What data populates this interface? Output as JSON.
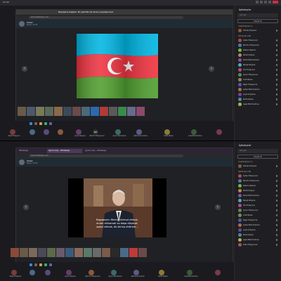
{
  "top": {
    "teams_bar": {
      "time": "23:30"
    },
    "tabs": [
      {
        "label": "WhatsApp"
      },
      {
        "label": "Ağ Ulu Göy - WhatsApp"
      }
    ],
    "banner": "Paylaşma başladı. Bu şəkildə siz ekranı paylaşırsınız",
    "url": "web.whatsapp.com",
    "chat": {
      "name": "Xəbər",
      "sub": "Bugün 12:00"
    },
    "media_alt": "flag-azerbaijan",
    "nav_prev": "‹",
    "nav_next": "›",
    "taskbar_time": "23:30",
    "attendees": [
      {
        "initials": "",
        "label": "Yasin Hüseynov",
        "color": "#7a3b3b"
      },
      {
        "initials": "",
        "label": "",
        "color": "#4a6a8a"
      },
      {
        "initials": "",
        "label": "",
        "color": "#5a4a7a"
      },
      {
        "initials": "",
        "label": "",
        "color": "#8a5a3a"
      },
      {
        "initials": "",
        "label": "Aynur Əliyeva",
        "color": "#6a3a6a"
      },
      {
        "initials": "NH",
        "label": "Nərmin Hüseynova",
        "color": "#303030"
      },
      {
        "initials": "",
        "label": "Aynur Əhmədova",
        "color": "#3a6a6a"
      },
      {
        "initials": "",
        "label": "Səbinə Axundova",
        "color": "#5a5a8a"
      },
      {
        "initials": "",
        "label": "Kamil Əliyev",
        "color": "#8a7a3a"
      },
      {
        "initials": "",
        "label": "Lalə Məmmədova",
        "color": "#3a5a3a"
      },
      {
        "initials": "",
        "label": "",
        "color": "#7a3a4a"
      }
    ]
  },
  "bottom": {
    "tabs": [
      {
        "label": "WhatsApp"
      },
      {
        "label": "Ağ Ulu Göy - WhatsApp"
      },
      {
        "label": "Ağ Ulu Göy - WhatsApp"
      }
    ],
    "url": "web.whatsapp.com",
    "chat": {
      "name": "Xəbər",
      "sub": "Bugün 12:00"
    },
    "subtitle_lines": [
      "Başqasının fikrinə hörmət etmək,",
      "onları dinləmək və başa düşmək,",
      "qəbul etmək, bir-birinə ehtiram..."
    ],
    "nav_prev": "‹",
    "nav_next": "›",
    "attendees": [
      {
        "initials": "",
        "label": "Yasin Hüseynov",
        "color": "#7a3b3b"
      },
      {
        "initials": "",
        "label": "",
        "color": "#4a6a8a"
      },
      {
        "initials": "",
        "label": "",
        "color": "#5a4a7a"
      },
      {
        "initials": "",
        "label": "Aynur Əliyeva",
        "color": "#6a3a6a"
      },
      {
        "initials": "",
        "label": "Nərmin Hüseynova",
        "color": "#8a5a3a"
      },
      {
        "initials": "",
        "label": "Aynur Əhmədova",
        "color": "#3a6a6a"
      },
      {
        "initials": "",
        "label": "Səbinə Axundova",
        "color": "#5a5a8a"
      },
      {
        "initials": "",
        "label": "Kamil Əliyev",
        "color": "#8a7a3a"
      },
      {
        "initials": "",
        "label": "Lalə Məmmədova",
        "color": "#3a5a3a"
      },
      {
        "initials": "",
        "label": "",
        "color": "#7a3a4a"
      }
    ]
  },
  "sidebar_top": {
    "title": "İştirakçılar",
    "search_placeholder": "Adı yaz",
    "invite_label": "Dəvət et",
    "section_presenters": "Təqdimatçılar (1)",
    "section_attendees": "İştirakçılar (28)",
    "presenter": {
      "name": "Vüsalə Quliyeva",
      "color": "#8a5a3a"
    },
    "people": [
      {
        "name": "Aytən Hüseynova",
        "color": "#b04a4a"
      },
      {
        "name": "Nərmin Hüseynova",
        "color": "#4a7ab0"
      },
      {
        "name": "Səbinə Əliyeva",
        "color": "#7ab04a"
      },
      {
        "name": "Ramil Quliyev",
        "color": "#b08a4a"
      },
      {
        "name": "Könül Məmmədova",
        "color": "#8a4ab0"
      },
      {
        "name": "Nərgiz Əliyeva",
        "color": "#4ab0a0"
      },
      {
        "name": "Ülvi Hüseynov",
        "color": "#b04a8a"
      },
      {
        "name": "Aynur Hüseynova",
        "color": "#5a8a5a"
      },
      {
        "name": "Yusif Əliyev",
        "color": "#8a8a4a"
      },
      {
        "name": "Nigar Hüseynova",
        "color": "#4a5ab0"
      },
      {
        "name": "Aydan Məmmədova",
        "color": "#b06a4a"
      },
      {
        "name": "Leyla Quliyeva",
        "color": "#6a4a8a"
      },
      {
        "name": "Kamil Əliyev",
        "color": "#4a8ab0"
      },
      {
        "name": "Aysel Məmmədova",
        "color": "#b0b04a"
      }
    ]
  },
  "sidebar_bottom": {
    "title": "İştirakçılar",
    "search_placeholder": "Adı yaz",
    "invite_label": "Dəvət et",
    "section_presenters": "Təqdimatçılar (1)",
    "section_attendees": "İştirakçılar (28)",
    "presenter": {
      "name": "Vüsalə Quliyeva",
      "color": "#8a5a3a"
    },
    "people": [
      {
        "name": "Aytən Hüseynova",
        "color": "#b04a4a"
      },
      {
        "name": "Nərmin Hüseynova",
        "color": "#4a7ab0"
      },
      {
        "name": "Səbinə Əliyeva",
        "color": "#7ab04a"
      },
      {
        "name": "Ramil Quliyev",
        "color": "#b08a4a"
      },
      {
        "name": "Könül Məmmədova",
        "color": "#8a4ab0"
      },
      {
        "name": "Nərgiz Əliyeva",
        "color": "#4ab0a0"
      },
      {
        "name": "Ülvi Hüseynov",
        "color": "#b04a8a"
      },
      {
        "name": "Aynur Hüseynova",
        "color": "#5a8a5a"
      },
      {
        "name": "Yusif Əliyev",
        "color": "#8a8a4a"
      },
      {
        "name": "Nigar Hüseynova",
        "color": "#4a5ab0"
      },
      {
        "name": "Aydan Məmmədova",
        "color": "#b06a4a"
      },
      {
        "name": "Leyla Quliyeva",
        "color": "#6a4a8a"
      },
      {
        "name": "Kamil Əliyev",
        "color": "#4a8ab0"
      },
      {
        "name": "Aysel Məmmədova",
        "color": "#b0b04a"
      },
      {
        "name": "Fidan Hüseynova",
        "color": "#b04a6a"
      }
    ]
  },
  "colors": {
    "flag_blue": "#00b5e2",
    "flag_red": "#ef3340",
    "flag_green": "#509e2f",
    "leave_red": "#c4314b"
  }
}
